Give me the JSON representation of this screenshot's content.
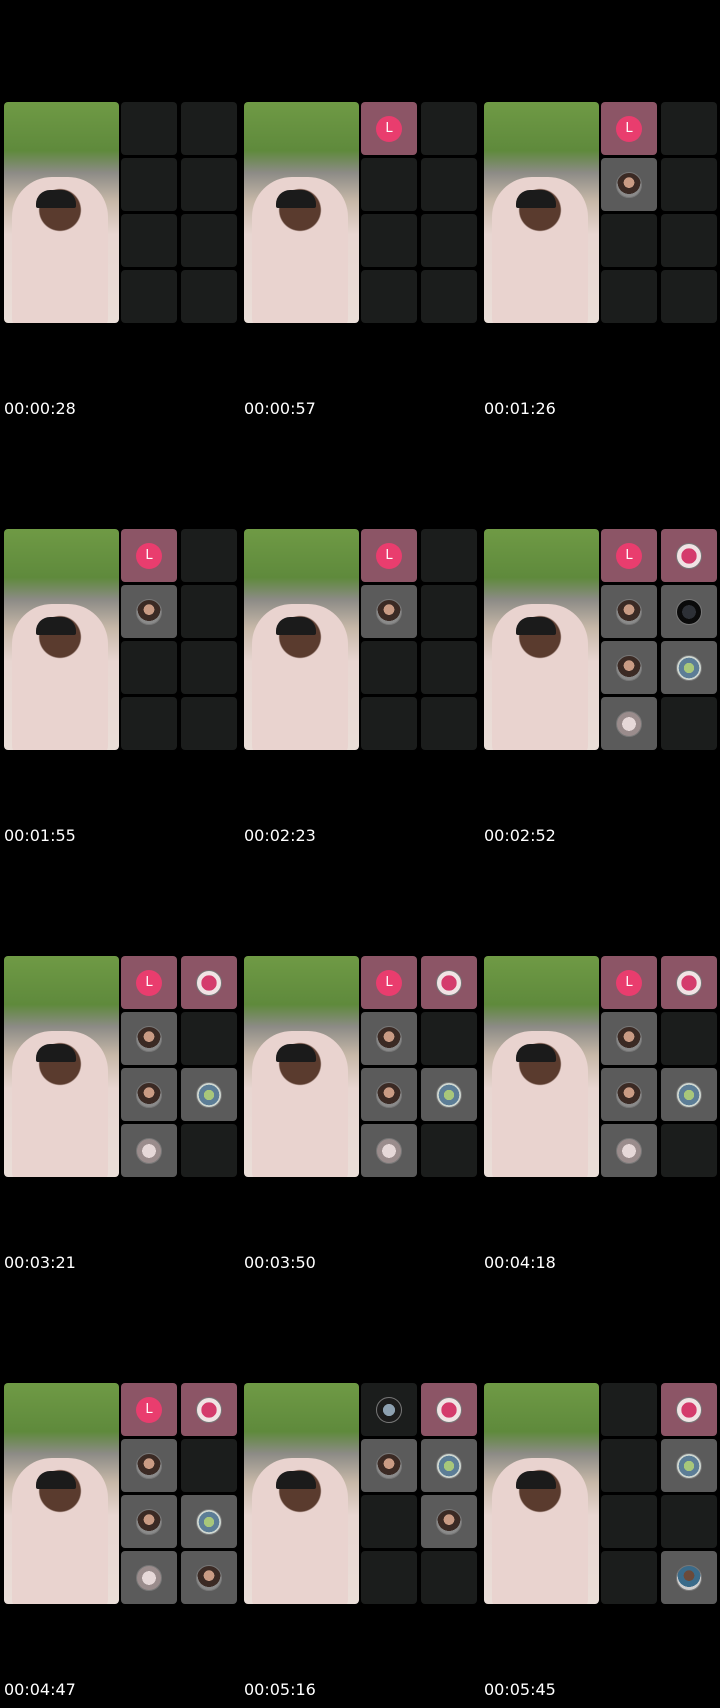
{
  "frames": [
    {
      "timestamp": "00:00:28",
      "tiles": [
        {
          "s": "empty"
        },
        {
          "s": "empty"
        },
        {
          "s": "empty"
        },
        {
          "s": "empty"
        },
        {
          "s": "empty"
        },
        {
          "s": "empty"
        },
        {
          "s": "empty"
        },
        {
          "s": "empty"
        }
      ]
    },
    {
      "timestamp": "00:00:57",
      "tiles": [
        {
          "s": "pink",
          "a": "letter",
          "t": "L"
        },
        {
          "s": "empty"
        },
        {
          "s": "empty"
        },
        {
          "s": "empty"
        },
        {
          "s": "empty"
        },
        {
          "s": "empty"
        },
        {
          "s": "empty"
        },
        {
          "s": "empty"
        }
      ]
    },
    {
      "timestamp": "00:01:26",
      "tiles": [
        {
          "s": "pink",
          "a": "letter",
          "t": "L"
        },
        {
          "s": "empty"
        },
        {
          "s": "filled",
          "a": "woman"
        },
        {
          "s": "empty"
        },
        {
          "s": "empty"
        },
        {
          "s": "empty"
        },
        {
          "s": "empty"
        },
        {
          "s": "empty"
        }
      ]
    },
    {
      "timestamp": "00:01:55",
      "tiles": [
        {
          "s": "pink",
          "a": "letter",
          "t": "L"
        },
        {
          "s": "empty"
        },
        {
          "s": "filled",
          "a": "woman"
        },
        {
          "s": "empty"
        },
        {
          "s": "empty"
        },
        {
          "s": "empty"
        },
        {
          "s": "empty"
        },
        {
          "s": "empty"
        }
      ]
    },
    {
      "timestamp": "00:02:23",
      "tiles": [
        {
          "s": "pink",
          "a": "letter",
          "t": "L"
        },
        {
          "s": "empty"
        },
        {
          "s": "filled",
          "a": "woman"
        },
        {
          "s": "empty"
        },
        {
          "s": "empty"
        },
        {
          "s": "empty"
        },
        {
          "s": "empty"
        },
        {
          "s": "empty"
        }
      ]
    },
    {
      "timestamp": "00:02:52",
      "tiles": [
        {
          "s": "pink",
          "a": "letter",
          "t": "L"
        },
        {
          "s": "pink",
          "a": "rose"
        },
        {
          "s": "filled",
          "a": "woman"
        },
        {
          "s": "filled",
          "a": "dark"
        },
        {
          "s": "filled",
          "a": "woman"
        },
        {
          "s": "filled",
          "a": "globe"
        },
        {
          "s": "filled",
          "a": "pale"
        },
        {
          "s": "empty"
        }
      ]
    },
    {
      "timestamp": "00:03:21",
      "tiles": [
        {
          "s": "pink",
          "a": "letter",
          "t": "L"
        },
        {
          "s": "pink",
          "a": "rose"
        },
        {
          "s": "filled",
          "a": "woman"
        },
        {
          "s": "empty"
        },
        {
          "s": "filled",
          "a": "woman"
        },
        {
          "s": "filled",
          "a": "globe"
        },
        {
          "s": "filled",
          "a": "pale"
        },
        {
          "s": "empty"
        }
      ]
    },
    {
      "timestamp": "00:03:50",
      "tiles": [
        {
          "s": "pink",
          "a": "letter",
          "t": "L"
        },
        {
          "s": "pink",
          "a": "rose"
        },
        {
          "s": "filled",
          "a": "woman"
        },
        {
          "s": "empty"
        },
        {
          "s": "filled",
          "a": "woman"
        },
        {
          "s": "filled",
          "a": "globe"
        },
        {
          "s": "filled",
          "a": "pale"
        },
        {
          "s": "empty"
        }
      ]
    },
    {
      "timestamp": "00:04:18",
      "tiles": [
        {
          "s": "pink",
          "a": "letter",
          "t": "L"
        },
        {
          "s": "pink",
          "a": "rose"
        },
        {
          "s": "filled",
          "a": "woman"
        },
        {
          "s": "empty"
        },
        {
          "s": "filled",
          "a": "woman"
        },
        {
          "s": "filled",
          "a": "globe"
        },
        {
          "s": "filled",
          "a": "pale"
        },
        {
          "s": "empty"
        }
      ]
    },
    {
      "timestamp": "00:04:47",
      "tiles": [
        {
          "s": "pink",
          "a": "letter",
          "t": "L"
        },
        {
          "s": "pink",
          "a": "rose"
        },
        {
          "s": "filled",
          "a": "woman"
        },
        {
          "s": "empty"
        },
        {
          "s": "filled",
          "a": "woman"
        },
        {
          "s": "filled",
          "a": "globe"
        },
        {
          "s": "filled",
          "a": "pale"
        },
        {
          "s": "filled",
          "a": "woman"
        }
      ]
    },
    {
      "timestamp": "00:05:16",
      "tiles": [
        {
          "s": "empty",
          "a": "brush"
        },
        {
          "s": "pink",
          "a": "rose"
        },
        {
          "s": "filled",
          "a": "woman"
        },
        {
          "s": "filled",
          "a": "globe"
        },
        {
          "s": "empty"
        },
        {
          "s": "filled",
          "a": "woman"
        },
        {
          "s": "empty"
        },
        {
          "s": "empty"
        }
      ]
    },
    {
      "timestamp": "00:05:45",
      "tiles": [
        {
          "s": "empty"
        },
        {
          "s": "pink",
          "a": "rose"
        },
        {
          "s": "empty"
        },
        {
          "s": "filled",
          "a": "globe"
        },
        {
          "s": "empty"
        },
        {
          "s": "empty"
        },
        {
          "s": "empty"
        },
        {
          "s": "filled",
          "a": "man"
        }
      ]
    }
  ]
}
